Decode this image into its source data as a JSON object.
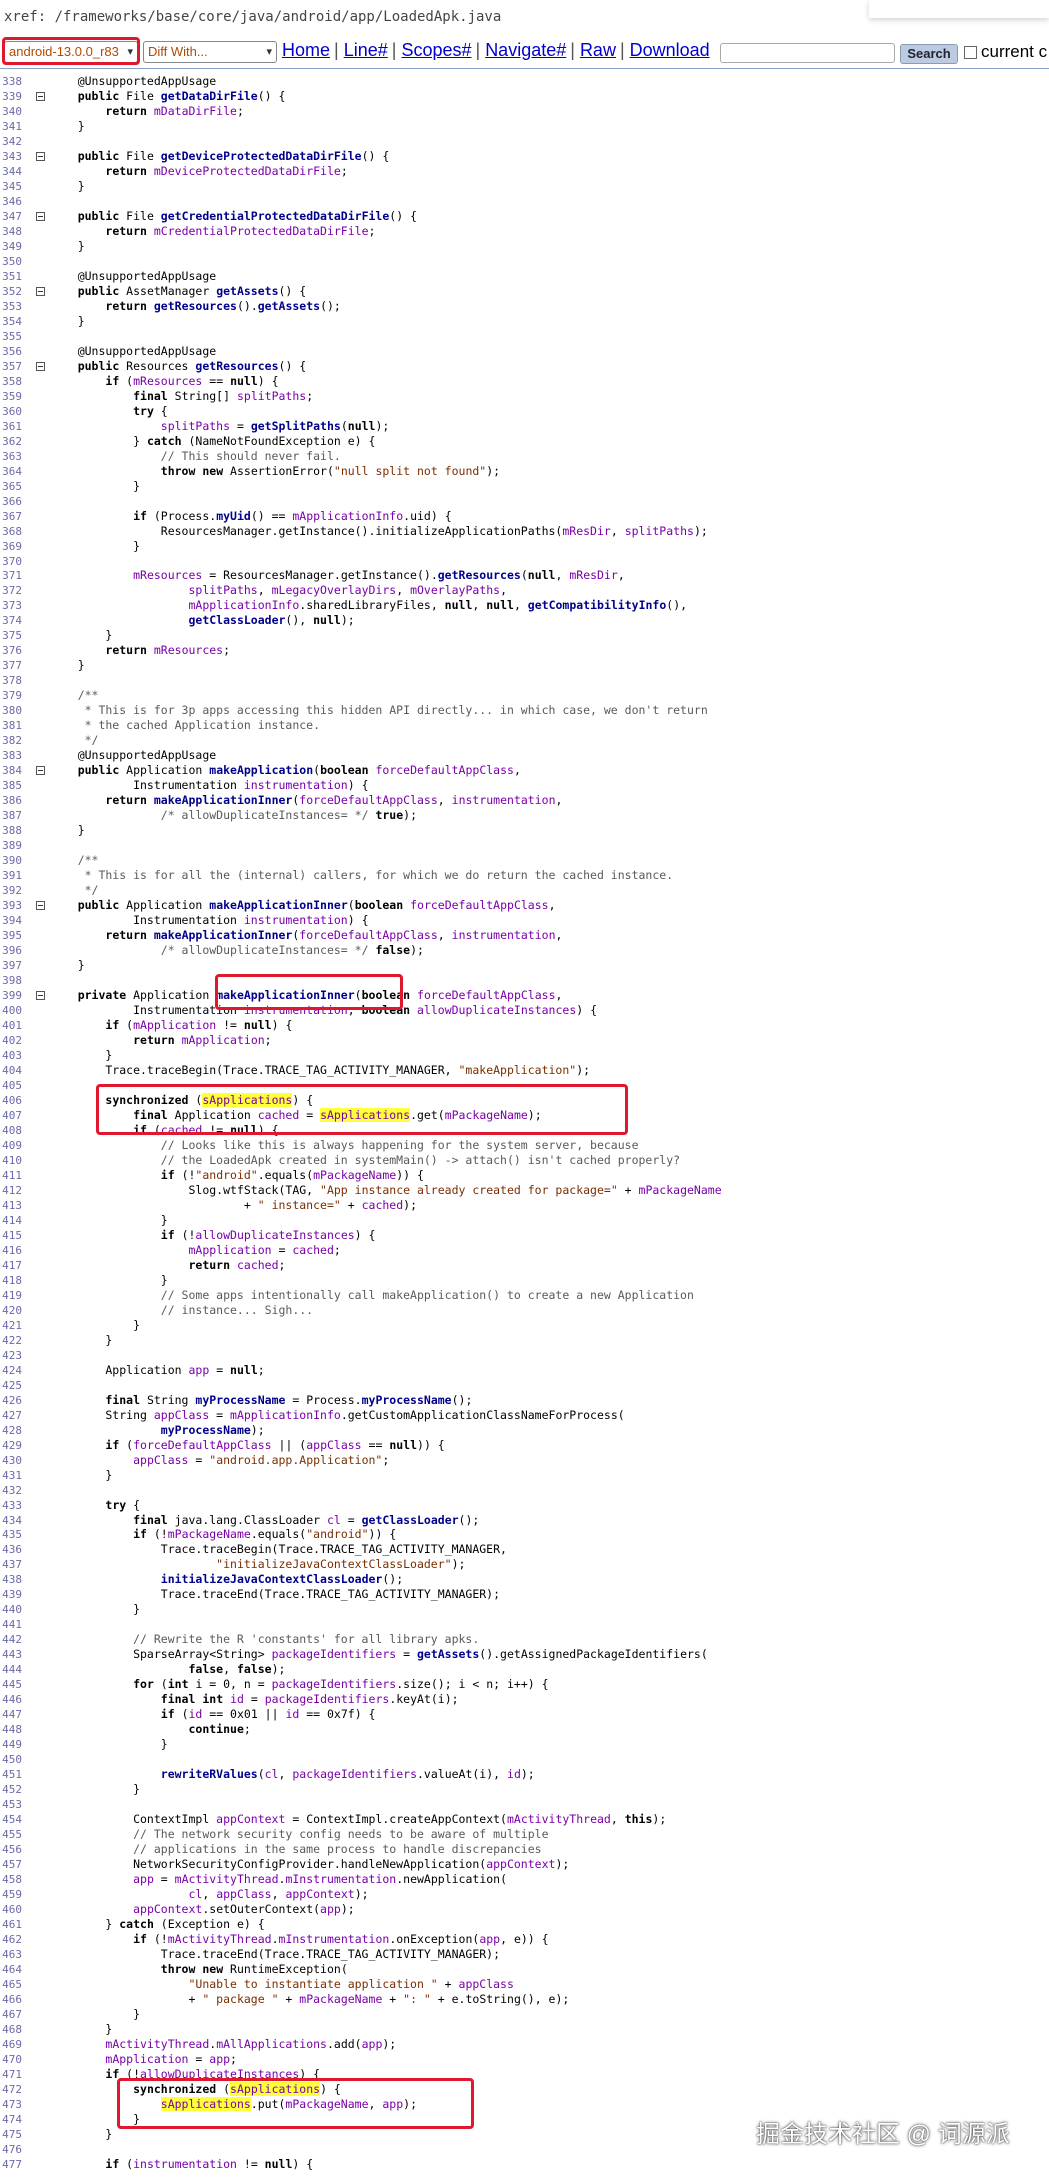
{
  "header": {
    "path": "xref: /frameworks/base/core/java/android/app/LoadedApk.java"
  },
  "toolbar": {
    "version_select": "android-13.0.0_r83",
    "diff_select": "Diff With...",
    "links": [
      "Home",
      "Line#",
      "Scopes#",
      "Navigate#",
      "Raw",
      "Download"
    ],
    "search_value": "",
    "search_button": "Search",
    "current_label": "current c"
  },
  "fold_lines": [
    339,
    343,
    347,
    352,
    357,
    384,
    393,
    399
  ],
  "code_lines": [
    {
      "n": 338,
      "t": "    @UnsupportedAppUsage"
    },
    {
      "n": 339,
      "t": "    public File getDataDirFile() {"
    },
    {
      "n": 340,
      "t": "        return mDataDirFile;"
    },
    {
      "n": 341,
      "t": "    }"
    },
    {
      "n": 342,
      "t": ""
    },
    {
      "n": 343,
      "t": "    public File getDeviceProtectedDataDirFile() {"
    },
    {
      "n": 344,
      "t": "        return mDeviceProtectedDataDirFile;"
    },
    {
      "n": 345,
      "t": "    }"
    },
    {
      "n": 346,
      "t": ""
    },
    {
      "n": 347,
      "t": "    public File getCredentialProtectedDataDirFile() {"
    },
    {
      "n": 348,
      "t": "        return mCredentialProtectedDataDirFile;"
    },
    {
      "n": 349,
      "t": "    }"
    },
    {
      "n": 350,
      "t": ""
    },
    {
      "n": 351,
      "t": "    @UnsupportedAppUsage"
    },
    {
      "n": 352,
      "t": "    public AssetManager getAssets() {"
    },
    {
      "n": 353,
      "t": "        return getResources().getAssets();"
    },
    {
      "n": 354,
      "t": "    }"
    },
    {
      "n": 355,
      "t": ""
    },
    {
      "n": 356,
      "t": "    @UnsupportedAppUsage"
    },
    {
      "n": 357,
      "t": "    public Resources getResources() {"
    },
    {
      "n": 358,
      "t": "        if (mResources == null) {"
    },
    {
      "n": 359,
      "t": "            final String[] splitPaths;"
    },
    {
      "n": 360,
      "t": "            try {"
    },
    {
      "n": 361,
      "t": "                splitPaths = getSplitPaths(null);"
    },
    {
      "n": 362,
      "t": "            } catch (NameNotFoundException e) {"
    },
    {
      "n": 363,
      "t": "                // This should never fail."
    },
    {
      "n": 364,
      "t": "                throw new AssertionError(\"null split not found\");"
    },
    {
      "n": 365,
      "t": "            }"
    },
    {
      "n": 366,
      "t": ""
    },
    {
      "n": 367,
      "t": "            if (Process.myUid() == mApplicationInfo.uid) {"
    },
    {
      "n": 368,
      "t": "                ResourcesManager.getInstance().initializeApplicationPaths(mResDir, splitPaths);"
    },
    {
      "n": 369,
      "t": "            }"
    },
    {
      "n": 370,
      "t": ""
    },
    {
      "n": 371,
      "t": "            mResources = ResourcesManager.getInstance().getResources(null, mResDir,"
    },
    {
      "n": 372,
      "t": "                    splitPaths, mLegacyOverlayDirs, mOverlayPaths,"
    },
    {
      "n": 373,
      "t": "                    mApplicationInfo.sharedLibraryFiles, null, null, getCompatibilityInfo(),"
    },
    {
      "n": 374,
      "t": "                    getClassLoader(), null);"
    },
    {
      "n": 375,
      "t": "        }"
    },
    {
      "n": 376,
      "t": "        return mResources;"
    },
    {
      "n": 377,
      "t": "    }"
    },
    {
      "n": 378,
      "t": ""
    },
    {
      "n": 379,
      "t": "    /**"
    },
    {
      "n": 380,
      "t": "     * This is for 3p apps accessing this hidden API directly... in which case, we don't return"
    },
    {
      "n": 381,
      "t": "     * the cached Application instance."
    },
    {
      "n": 382,
      "t": "     */"
    },
    {
      "n": 383,
      "t": "    @UnsupportedAppUsage"
    },
    {
      "n": 384,
      "t": "    public Application makeApplication(boolean forceDefaultAppClass,"
    },
    {
      "n": 385,
      "t": "            Instrumentation instrumentation) {"
    },
    {
      "n": 386,
      "t": "        return makeApplicationInner(forceDefaultAppClass, instrumentation,"
    },
    {
      "n": 387,
      "t": "                /* allowDuplicateInstances= */ true);"
    },
    {
      "n": 388,
      "t": "    }"
    },
    {
      "n": 389,
      "t": ""
    },
    {
      "n": 390,
      "t": "    /**"
    },
    {
      "n": 391,
      "t": "     * This is for all the (internal) callers, for which we do return the cached instance."
    },
    {
      "n": 392,
      "t": "     */"
    },
    {
      "n": 393,
      "t": "    public Application makeApplicationInner(boolean forceDefaultAppClass,"
    },
    {
      "n": 394,
      "t": "            Instrumentation instrumentation) {"
    },
    {
      "n": 395,
      "t": "        return makeApplicationInner(forceDefaultAppClass, instrumentation,"
    },
    {
      "n": 396,
      "t": "                /* allowDuplicateInstances= */ false);"
    },
    {
      "n": 397,
      "t": "    }"
    },
    {
      "n": 398,
      "t": ""
    },
    {
      "n": 399,
      "t": "    private Application makeApplicationInner(boolean forceDefaultAppClass,"
    },
    {
      "n": 400,
      "t": "            Instrumentation instrumentation, boolean allowDuplicateInstances) {"
    },
    {
      "n": 401,
      "t": "        if (mApplication != null) {"
    },
    {
      "n": 402,
      "t": "            return mApplication;"
    },
    {
      "n": 403,
      "t": "        }"
    },
    {
      "n": 404,
      "t": "        Trace.traceBegin(Trace.TRACE_TAG_ACTIVITY_MANAGER, \"makeApplication\");"
    },
    {
      "n": 405,
      "t": ""
    },
    {
      "n": 406,
      "t": "        synchronized (sApplications) {"
    },
    {
      "n": 407,
      "t": "            final Application cached = sApplications.get(mPackageName);"
    },
    {
      "n": 408,
      "t": "            if (cached != null) {"
    },
    {
      "n": 409,
      "t": "                // Looks like this is always happening for the system server, because"
    },
    {
      "n": 410,
      "t": "                // the LoadedApk created in systemMain() -> attach() isn't cached properly?"
    },
    {
      "n": 411,
      "t": "                if (!\"android\".equals(mPackageName)) {"
    },
    {
      "n": 412,
      "t": "                    Slog.wtfStack(TAG, \"App instance already created for package=\" + mPackageName"
    },
    {
      "n": 413,
      "t": "                            + \" instance=\" + cached);"
    },
    {
      "n": 414,
      "t": "                }"
    },
    {
      "n": 415,
      "t": "                if (!allowDuplicateInstances) {"
    },
    {
      "n": 416,
      "t": "                    mApplication = cached;"
    },
    {
      "n": 417,
      "t": "                    return cached;"
    },
    {
      "n": 418,
      "t": "                }"
    },
    {
      "n": 419,
      "t": "                // Some apps intentionally call makeApplication() to create a new Application"
    },
    {
      "n": 420,
      "t": "                // instance... Sigh..."
    },
    {
      "n": 421,
      "t": "            }"
    },
    {
      "n": 422,
      "t": "        }"
    },
    {
      "n": 423,
      "t": ""
    },
    {
      "n": 424,
      "t": "        Application app = null;"
    },
    {
      "n": 425,
      "t": ""
    },
    {
      "n": 426,
      "t": "        final String myProcessName = Process.myProcessName();"
    },
    {
      "n": 427,
      "t": "        String appClass = mApplicationInfo.getCustomApplicationClassNameForProcess("
    },
    {
      "n": 428,
      "t": "                myProcessName);"
    },
    {
      "n": 429,
      "t": "        if (forceDefaultAppClass || (appClass == null)) {"
    },
    {
      "n": 430,
      "t": "            appClass = \"android.app.Application\";"
    },
    {
      "n": 431,
      "t": "        }"
    },
    {
      "n": 432,
      "t": ""
    },
    {
      "n": 433,
      "t": "        try {"
    },
    {
      "n": 434,
      "t": "            final java.lang.ClassLoader cl = getClassLoader();"
    },
    {
      "n": 435,
      "t": "            if (!mPackageName.equals(\"android\")) {"
    },
    {
      "n": 436,
      "t": "                Trace.traceBegin(Trace.TRACE_TAG_ACTIVITY_MANAGER,"
    },
    {
      "n": 437,
      "t": "                        \"initializeJavaContextClassLoader\");"
    },
    {
      "n": 438,
      "t": "                initializeJavaContextClassLoader();"
    },
    {
      "n": 439,
      "t": "                Trace.traceEnd(Trace.TRACE_TAG_ACTIVITY_MANAGER);"
    },
    {
      "n": 440,
      "t": "            }"
    },
    {
      "n": 441,
      "t": ""
    },
    {
      "n": 442,
      "t": "            // Rewrite the R 'constants' for all library apks."
    },
    {
      "n": 443,
      "t": "            SparseArray<String> packageIdentifiers = getAssets().getAssignedPackageIdentifiers("
    },
    {
      "n": 444,
      "t": "                    false, false);"
    },
    {
      "n": 445,
      "t": "            for (int i = 0, n = packageIdentifiers.size(); i < n; i++) {"
    },
    {
      "n": 446,
      "t": "                final int id = packageIdentifiers.keyAt(i);"
    },
    {
      "n": 447,
      "t": "                if (id == 0x01 || id == 0x7f) {"
    },
    {
      "n": 448,
      "t": "                    continue;"
    },
    {
      "n": 449,
      "t": "                }"
    },
    {
      "n": 450,
      "t": ""
    },
    {
      "n": 451,
      "t": "                rewriteRValues(cl, packageIdentifiers.valueAt(i), id);"
    },
    {
      "n": 452,
      "t": "            }"
    },
    {
      "n": 453,
      "t": ""
    },
    {
      "n": 454,
      "t": "            ContextImpl appContext = ContextImpl.createAppContext(mActivityThread, this);"
    },
    {
      "n": 455,
      "t": "            // The network security config needs to be aware of multiple"
    },
    {
      "n": 456,
      "t": "            // applications in the same process to handle discrepancies"
    },
    {
      "n": 457,
      "t": "            NetworkSecurityConfigProvider.handleNewApplication(appContext);"
    },
    {
      "n": 458,
      "t": "            app = mActivityThread.mInstrumentation.newApplication("
    },
    {
      "n": 459,
      "t": "                    cl, appClass, appContext);"
    },
    {
      "n": 460,
      "t": "            appContext.setOuterContext(app);"
    },
    {
      "n": 461,
      "t": "        } catch (Exception e) {"
    },
    {
      "n": 462,
      "t": "            if (!mActivityThread.mInstrumentation.onException(app, e)) {"
    },
    {
      "n": 463,
      "t": "                Trace.traceEnd(Trace.TRACE_TAG_ACTIVITY_MANAGER);"
    },
    {
      "n": 464,
      "t": "                throw new RuntimeException("
    },
    {
      "n": 465,
      "t": "                    \"Unable to instantiate application \" + appClass"
    },
    {
      "n": 466,
      "t": "                    + \" package \" + mPackageName + \": \" + e.toString(), e);"
    },
    {
      "n": 467,
      "t": "            }"
    },
    {
      "n": 468,
      "t": "        }"
    },
    {
      "n": 469,
      "t": "        mActivityThread.mAllApplications.add(app);"
    },
    {
      "n": 470,
      "t": "        mApplication = app;"
    },
    {
      "n": 471,
      "t": "        if (!allowDuplicateInstances) {"
    },
    {
      "n": 472,
      "t": "            synchronized (sApplications) {"
    },
    {
      "n": 473,
      "t": "                sApplications.put(mPackageName, app);"
    },
    {
      "n": 474,
      "t": "            }"
    },
    {
      "n": 475,
      "t": "        }"
    },
    {
      "n": 476,
      "t": ""
    },
    {
      "n": 477,
      "t": "        if (instrumentation != null) {"
    }
  ],
  "highlights": [
    "sApplications"
  ],
  "watermark": "掘金技术社区 @ 词源派"
}
